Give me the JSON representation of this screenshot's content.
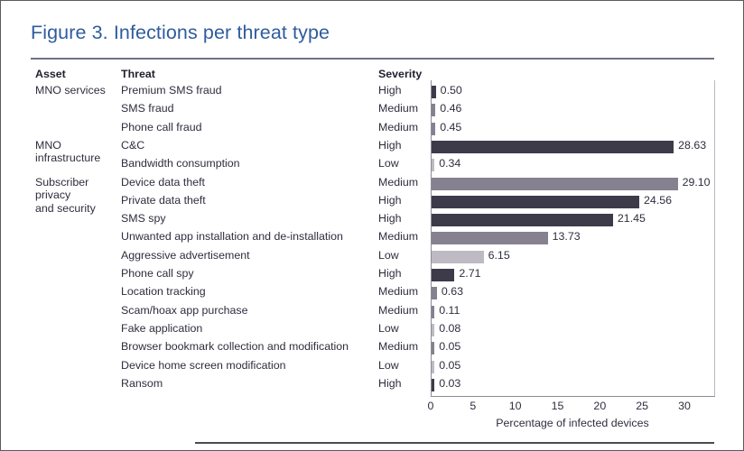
{
  "figure": {
    "title": "Figure 3. Infections per threat type",
    "title_color": "#2f5c9e"
  },
  "table": {
    "headers": {
      "asset": "Asset",
      "threat": "Threat",
      "severity": "Severity"
    },
    "asset_groups": [
      {
        "label": "MNO services",
        "start_row": 0
      },
      {
        "label": "MNO\ninfrastructure",
        "start_row": 3
      },
      {
        "label": "Subscriber\nprivacy\nand security",
        "start_row": 5
      }
    ]
  },
  "severity_colors": {
    "High": "#3d3b4a",
    "Medium": "#86818f",
    "Low": "#bdbac4"
  },
  "chart_data": {
    "type": "bar",
    "orientation": "horizontal",
    "title": "Figure 3. Infections per threat type",
    "xlabel": "Percentage of infected devices",
    "ylabel": "",
    "xlim": [
      0,
      30
    ],
    "xticks": [
      0,
      5,
      10,
      15,
      20,
      25,
      30
    ],
    "xticklabels": [
      "0",
      "5",
      "10",
      "15",
      "20",
      "25",
      "30"
    ],
    "grid": false,
    "legend": false,
    "categories": [
      "Premium SMS fraud",
      "SMS fraud",
      "Phone call fraud",
      "C&C",
      "Bandwidth consumption",
      "Device data theft",
      "Private data theft",
      "SMS spy",
      "Unwanted app installation and de-installation",
      "Aggressive advertisement",
      "Phone call spy",
      "Location tracking",
      "Scam/hoax app purchase",
      "Fake application",
      "Browser bookmark collection and modification",
      "Device home screen modification",
      "Ransom"
    ],
    "values": [
      0.5,
      0.46,
      0.45,
      28.63,
      0.34,
      29.1,
      24.56,
      21.45,
      13.73,
      6.15,
      2.71,
      0.63,
      0.11,
      0.08,
      0.05,
      0.05,
      0.03
    ],
    "value_labels": [
      "0.50",
      "0.46",
      "0.45",
      "28.63",
      "0.34",
      "29.10",
      "24.56",
      "21.45",
      "13.73",
      "6.15",
      "2.71",
      "0.63",
      "0.11",
      "0.08",
      "0.05",
      "0.05",
      "0.03"
    ],
    "severities": [
      "High",
      "Medium",
      "Medium",
      "High",
      "Low",
      "Medium",
      "High",
      "High",
      "Medium",
      "Low",
      "High",
      "Medium",
      "Medium",
      "Low",
      "Medium",
      "Low",
      "High"
    ],
    "assets": [
      "MNO services",
      "MNO services",
      "MNO services",
      "MNO infrastructure",
      "MNO infrastructure",
      "Subscriber privacy and security",
      "Subscriber privacy and security",
      "Subscriber privacy and security",
      "Subscriber privacy and security",
      "Subscriber privacy and security",
      "Subscriber privacy and security",
      "Subscriber privacy and security",
      "Subscriber privacy and security",
      "Subscriber privacy and security",
      "Subscriber privacy and security",
      "Subscriber privacy and security",
      "Subscriber privacy and security"
    ]
  }
}
